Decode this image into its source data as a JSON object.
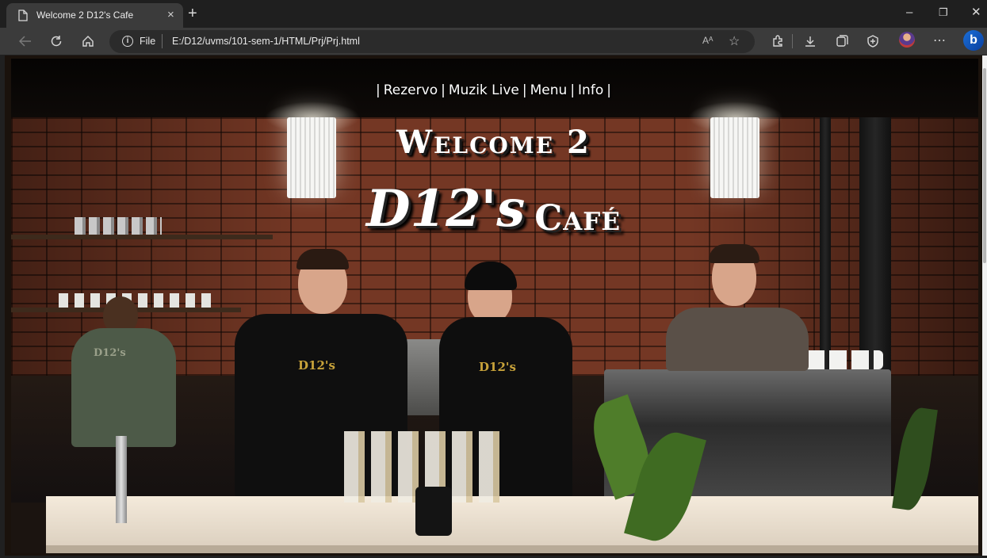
{
  "browser": {
    "tab_title": "Welcome 2 D12's Cafe",
    "tab_close": "×",
    "new_tab": "+",
    "address_scheme_label": "File",
    "address_url": "E:/D12/uvms/101-sem-1/HTML/Prj/Prj.html",
    "read_aloud_label": "Aᴬ",
    "win_minimize": "–",
    "win_restore": "❐",
    "win_close": "✕"
  },
  "icons": {
    "back": "back-arrow-icon",
    "refresh": "refresh-icon",
    "home": "home-icon",
    "info": "info-icon",
    "favorite": "star-icon",
    "extensions": "extensions-icon",
    "downloads": "download-icon",
    "collections": "collections-icon",
    "security": "browser-essentials-icon",
    "more": "more-icon",
    "bing": "bing-icon"
  },
  "page": {
    "nav": {
      "sep": "|",
      "items": [
        "Rezervo",
        "Muzik Live",
        "Menu",
        "Info"
      ]
    },
    "welcome": "Welcome 2",
    "brand": "D12's",
    "cafe": "Café"
  },
  "colors": {
    "accent_bing": "#1b6fd8",
    "brick": "#7a3a26",
    "logo_gold": "#c7a23a"
  }
}
